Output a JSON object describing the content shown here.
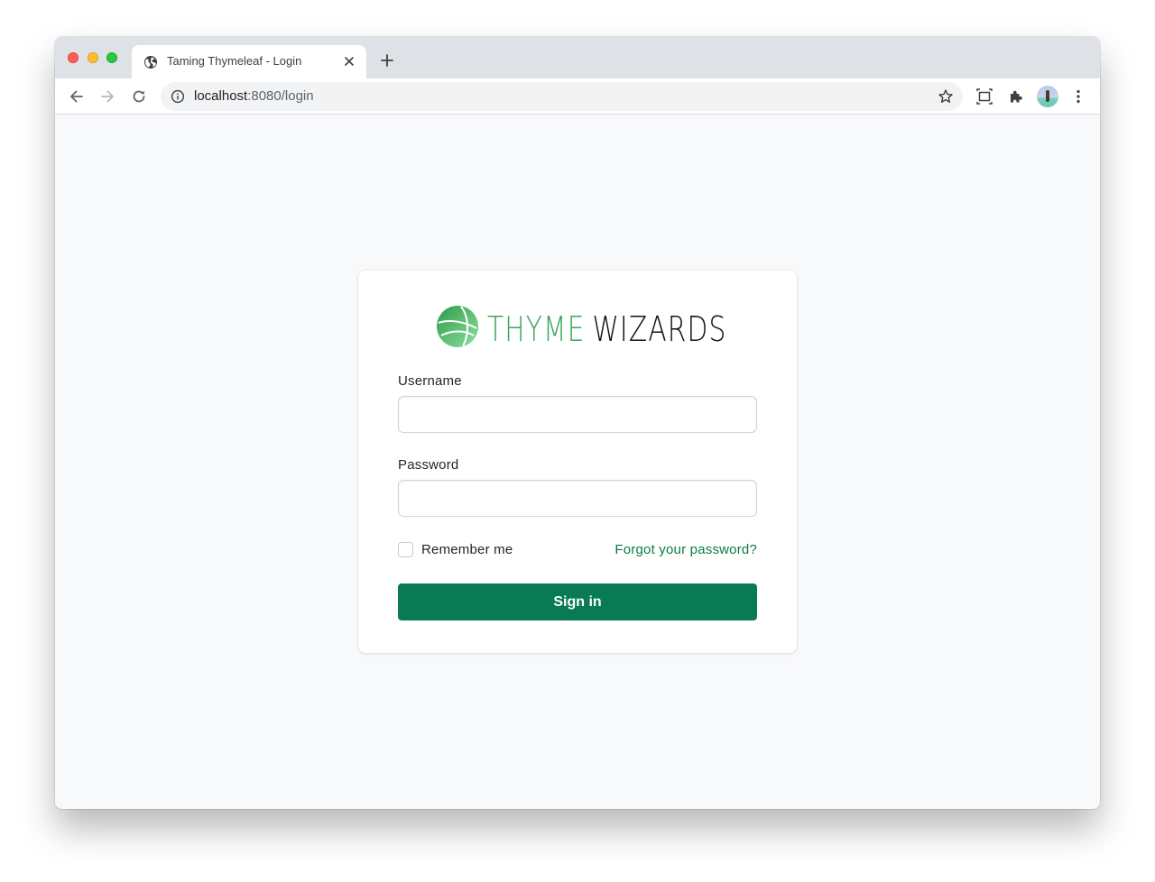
{
  "browser": {
    "tab": {
      "title": "Taming Thymeleaf - Login",
      "icon": "globe-icon"
    },
    "url_host": "localhost",
    "url_rest": ":8080/login",
    "toolbar_icons": [
      "back-arrow-icon",
      "forward-arrow-icon",
      "reload-icon",
      "info-icon",
      "star-icon",
      "screen-capture-icon",
      "extensions-puzzle-icon",
      "avatar",
      "more-vert-icon"
    ]
  },
  "logo": {
    "word1": "THYME",
    "word2": "WIZARDS",
    "icon": "globe-logo-icon"
  },
  "form": {
    "username_label": "Username",
    "username_value": "",
    "password_label": "Password",
    "password_value": "",
    "remember_label": "Remember me",
    "remember_checked": false,
    "forgot_link": "Forgot your password?",
    "submit_label": "Sign in"
  },
  "colors": {
    "primary": "#087b55",
    "link": "#0a7a44",
    "logo_green": "#3aa55a",
    "page_bg": "#f8f9fb"
  }
}
